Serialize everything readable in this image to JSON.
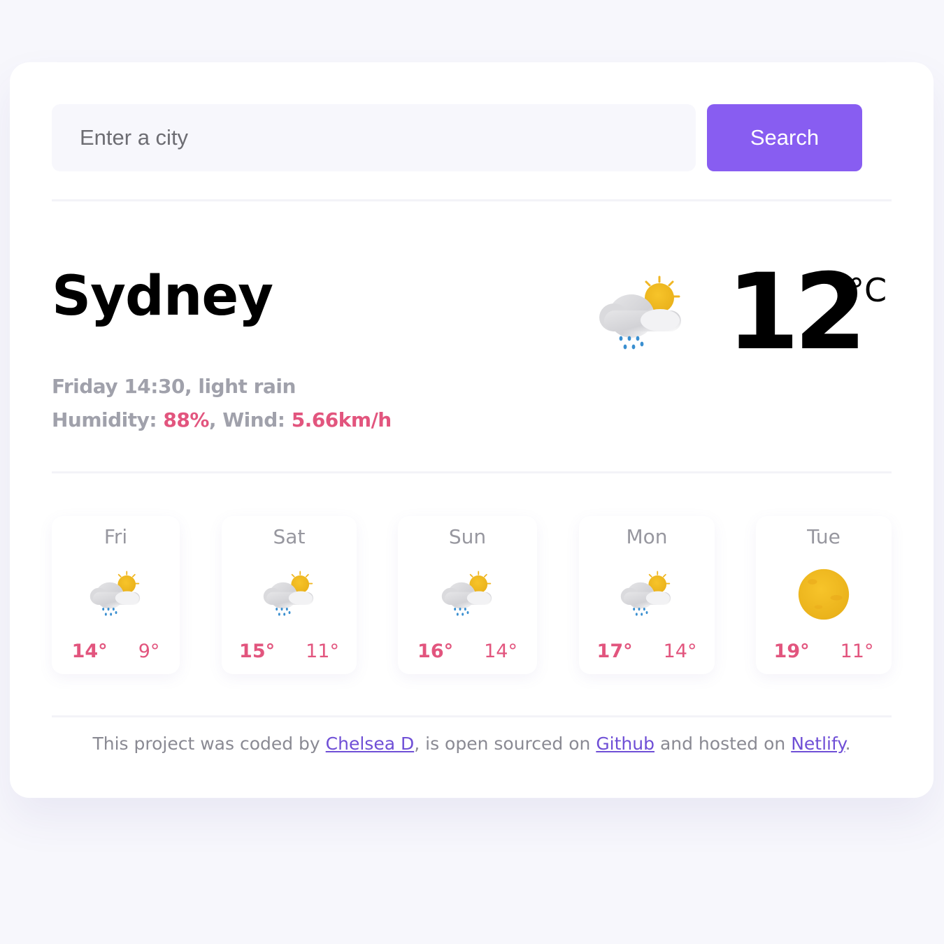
{
  "search": {
    "placeholder": "Enter a city",
    "value": "",
    "button_label": "Search"
  },
  "current": {
    "city": "Sydney",
    "datetime": "Friday 14:30",
    "description": "light rain",
    "humidity_label": "Humidity:",
    "humidity_value": "88%",
    "wind_label": "Wind:",
    "wind_value": "5.66km/h",
    "temperature": "12",
    "unit": "°C",
    "icon": "rain-sun-icon"
  },
  "forecast": [
    {
      "day": "Fri",
      "max": "14°",
      "min": "9°",
      "icon": "rain-sun-icon"
    },
    {
      "day": "Sat",
      "max": "15°",
      "min": "11°",
      "icon": "rain-sun-icon"
    },
    {
      "day": "Sun",
      "max": "16°",
      "min": "14°",
      "icon": "rain-sun-icon"
    },
    {
      "day": "Mon",
      "max": "17°",
      "min": "14°",
      "icon": "rain-sun-icon"
    },
    {
      "day": "Tue",
      "max": "19°",
      "min": "11°",
      "icon": "sun-icon"
    }
  ],
  "footer": {
    "text_1": "This project was coded by ",
    "author_link": "Chelsea D",
    "text_2": ", is open sourced on ",
    "github_link": "Github",
    "text_3": " and hosted on ",
    "netlify_link": "Netlify",
    "text_4": "."
  },
  "colors": {
    "accent": "#885df1",
    "highlight": "#e2557e",
    "muted_text": "#a0a1ab",
    "background": "#f7f7fc"
  }
}
